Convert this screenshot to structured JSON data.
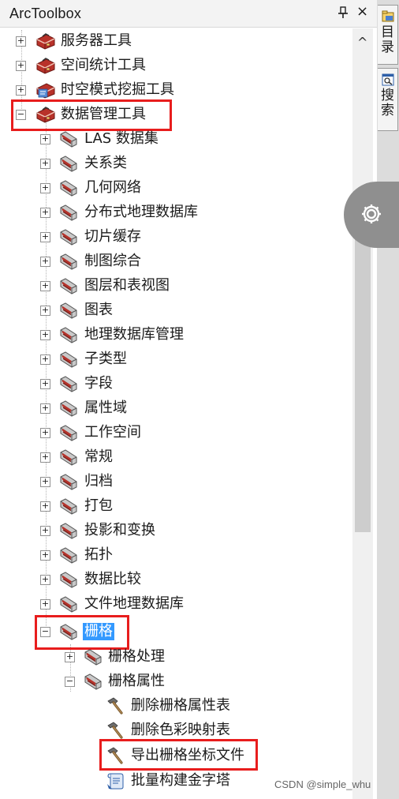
{
  "panel": {
    "title": "ArcToolbox",
    "pin_icon": "pin-icon",
    "close_label": "×"
  },
  "side_tabs": [
    {
      "label": "目录",
      "icon": "catalog-icon"
    },
    {
      "label": "搜索",
      "icon": "search-window-icon"
    }
  ],
  "gear_icon": "gear-icon",
  "scrollbar": {
    "up_arrow": "^"
  },
  "tree": {
    "top_level": [
      {
        "label": "服务器工具",
        "expander": "+",
        "icon": "toolbox-icon"
      },
      {
        "label": "空间统计工具",
        "expander": "+",
        "icon": "toolbox-icon"
      },
      {
        "label": "时空模式挖掘工具",
        "expander": "+",
        "icon": "toolbox-script-icon"
      },
      {
        "label": "数据管理工具",
        "expander": "−",
        "icon": "toolbox-icon",
        "highlighted": true
      }
    ],
    "data_management_children": [
      {
        "label": "LAS 数据集",
        "expander": "+"
      },
      {
        "label": "关系类",
        "expander": "+"
      },
      {
        "label": "几何网络",
        "expander": "+"
      },
      {
        "label": "分布式地理数据库",
        "expander": "+"
      },
      {
        "label": "切片缓存",
        "expander": "+"
      },
      {
        "label": "制图综合",
        "expander": "+"
      },
      {
        "label": "图层和表视图",
        "expander": "+"
      },
      {
        "label": "图表",
        "expander": "+"
      },
      {
        "label": "地理数据库管理",
        "expander": "+"
      },
      {
        "label": "子类型",
        "expander": "+"
      },
      {
        "label": "字段",
        "expander": "+"
      },
      {
        "label": "属性域",
        "expander": "+"
      },
      {
        "label": "工作空间",
        "expander": "+"
      },
      {
        "label": "常规",
        "expander": "+"
      },
      {
        "label": "归档",
        "expander": "+"
      },
      {
        "label": "打包",
        "expander": "+"
      },
      {
        "label": "投影和变换",
        "expander": "+"
      },
      {
        "label": "拓扑",
        "expander": "+"
      },
      {
        "label": "数据比较",
        "expander": "+"
      },
      {
        "label": "文件地理数据库",
        "expander": "+"
      },
      {
        "label": "栅格",
        "expander": "−",
        "selected": true,
        "highlighted": true
      }
    ],
    "raster_children": [
      {
        "label": "栅格处理",
        "expander": "+"
      },
      {
        "label": "栅格属性",
        "expander": "−"
      }
    ],
    "raster_properties_tools": [
      {
        "label": "删除栅格属性表",
        "icon": "hammer-icon"
      },
      {
        "label": "删除色彩映射表",
        "icon": "hammer-icon"
      },
      {
        "label": "导出栅格坐标文件",
        "icon": "hammer-icon",
        "highlighted": true
      },
      {
        "label": "批量构建金字塔",
        "icon": "script-tool-icon"
      }
    ]
  },
  "watermark": "CSDN @simple_whu",
  "colors": {
    "highlight_box": "#e81d1d",
    "selection": "#3399ff",
    "toolbox_red": "#c0392b",
    "gear_tab": "#8f8f8f"
  }
}
